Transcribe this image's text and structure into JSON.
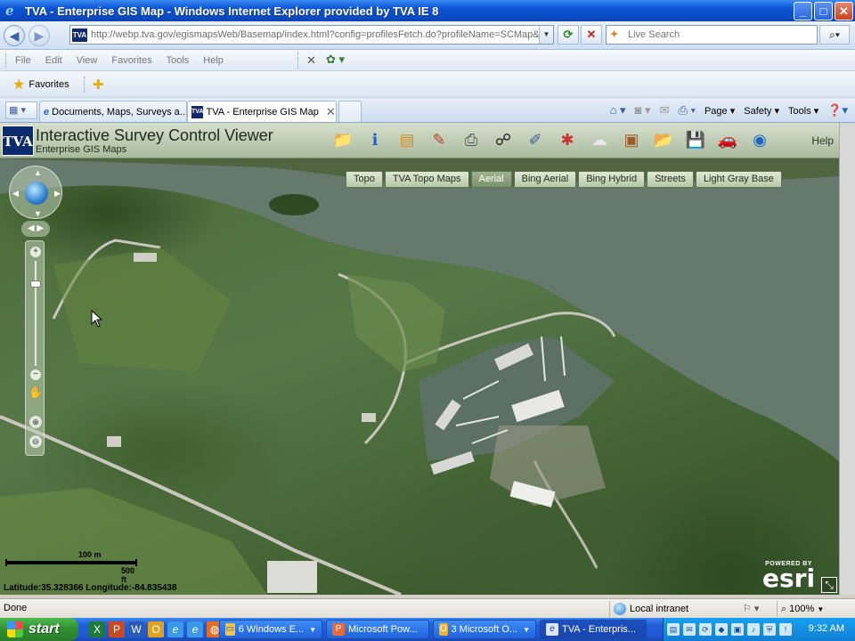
{
  "window": {
    "title": "TVA - Enterprise GIS Map - Windows Internet Explorer provided by TVA IE 8",
    "btn_min": "_",
    "btn_max": "□",
    "btn_close": "✕"
  },
  "address": {
    "url": "http://webp.tva.gov/egismapsWeb/Basemap/index.html?config=profilesFetch.do?profileName=SCMap&request=",
    "search_placeholder": "Live Search"
  },
  "menu": {
    "items": [
      "File",
      "Edit",
      "View",
      "Favorites",
      "Tools",
      "Help"
    ]
  },
  "favorites": {
    "label": "Favorites"
  },
  "tabs": [
    {
      "label": "Documents, Maps, Surveys a..."
    },
    {
      "label": "TVA - Enterprise GIS Map"
    }
  ],
  "commandbar": {
    "page": "Page ▾",
    "safety": "Safety ▾",
    "tools": "Tools ▾"
  },
  "viewer": {
    "logo": "TVA",
    "title": "Interactive Survey Control Viewer",
    "subtitle": "Enterprise GIS Maps",
    "help": "Help"
  },
  "basemaps": {
    "options": [
      "Topo",
      "TVA Topo Maps",
      "Aerial",
      "Bing Aerial",
      "Bing Hybrid",
      "Streets",
      "Light Gray Base"
    ],
    "selected": "Aerial"
  },
  "map": {
    "scale_top": "100 m",
    "scale_bottom": "500 ft",
    "latitude": "Latitude:35.328366",
    "longitude": "Longitude:-84.835438",
    "esri_powered": "POWERED BY",
    "esri_name": "esri"
  },
  "status": {
    "text": "Done",
    "zone": "Local intranet",
    "zoom": "100%"
  },
  "taskbar": {
    "start": "start",
    "buttons": [
      {
        "label": "6 Windows E..."
      },
      {
        "label": "Microsoft Pow..."
      },
      {
        "label": "3 Microsoft O..."
      },
      {
        "label": "TVA - Enterpris..."
      }
    ],
    "time": "9:32 AM"
  },
  "colors": {
    "title_bar": "#0a53d4",
    "viewer_header": "#a9bb9e",
    "taskbar": "#225ed8",
    "start_button": "#2e8d2e"
  }
}
